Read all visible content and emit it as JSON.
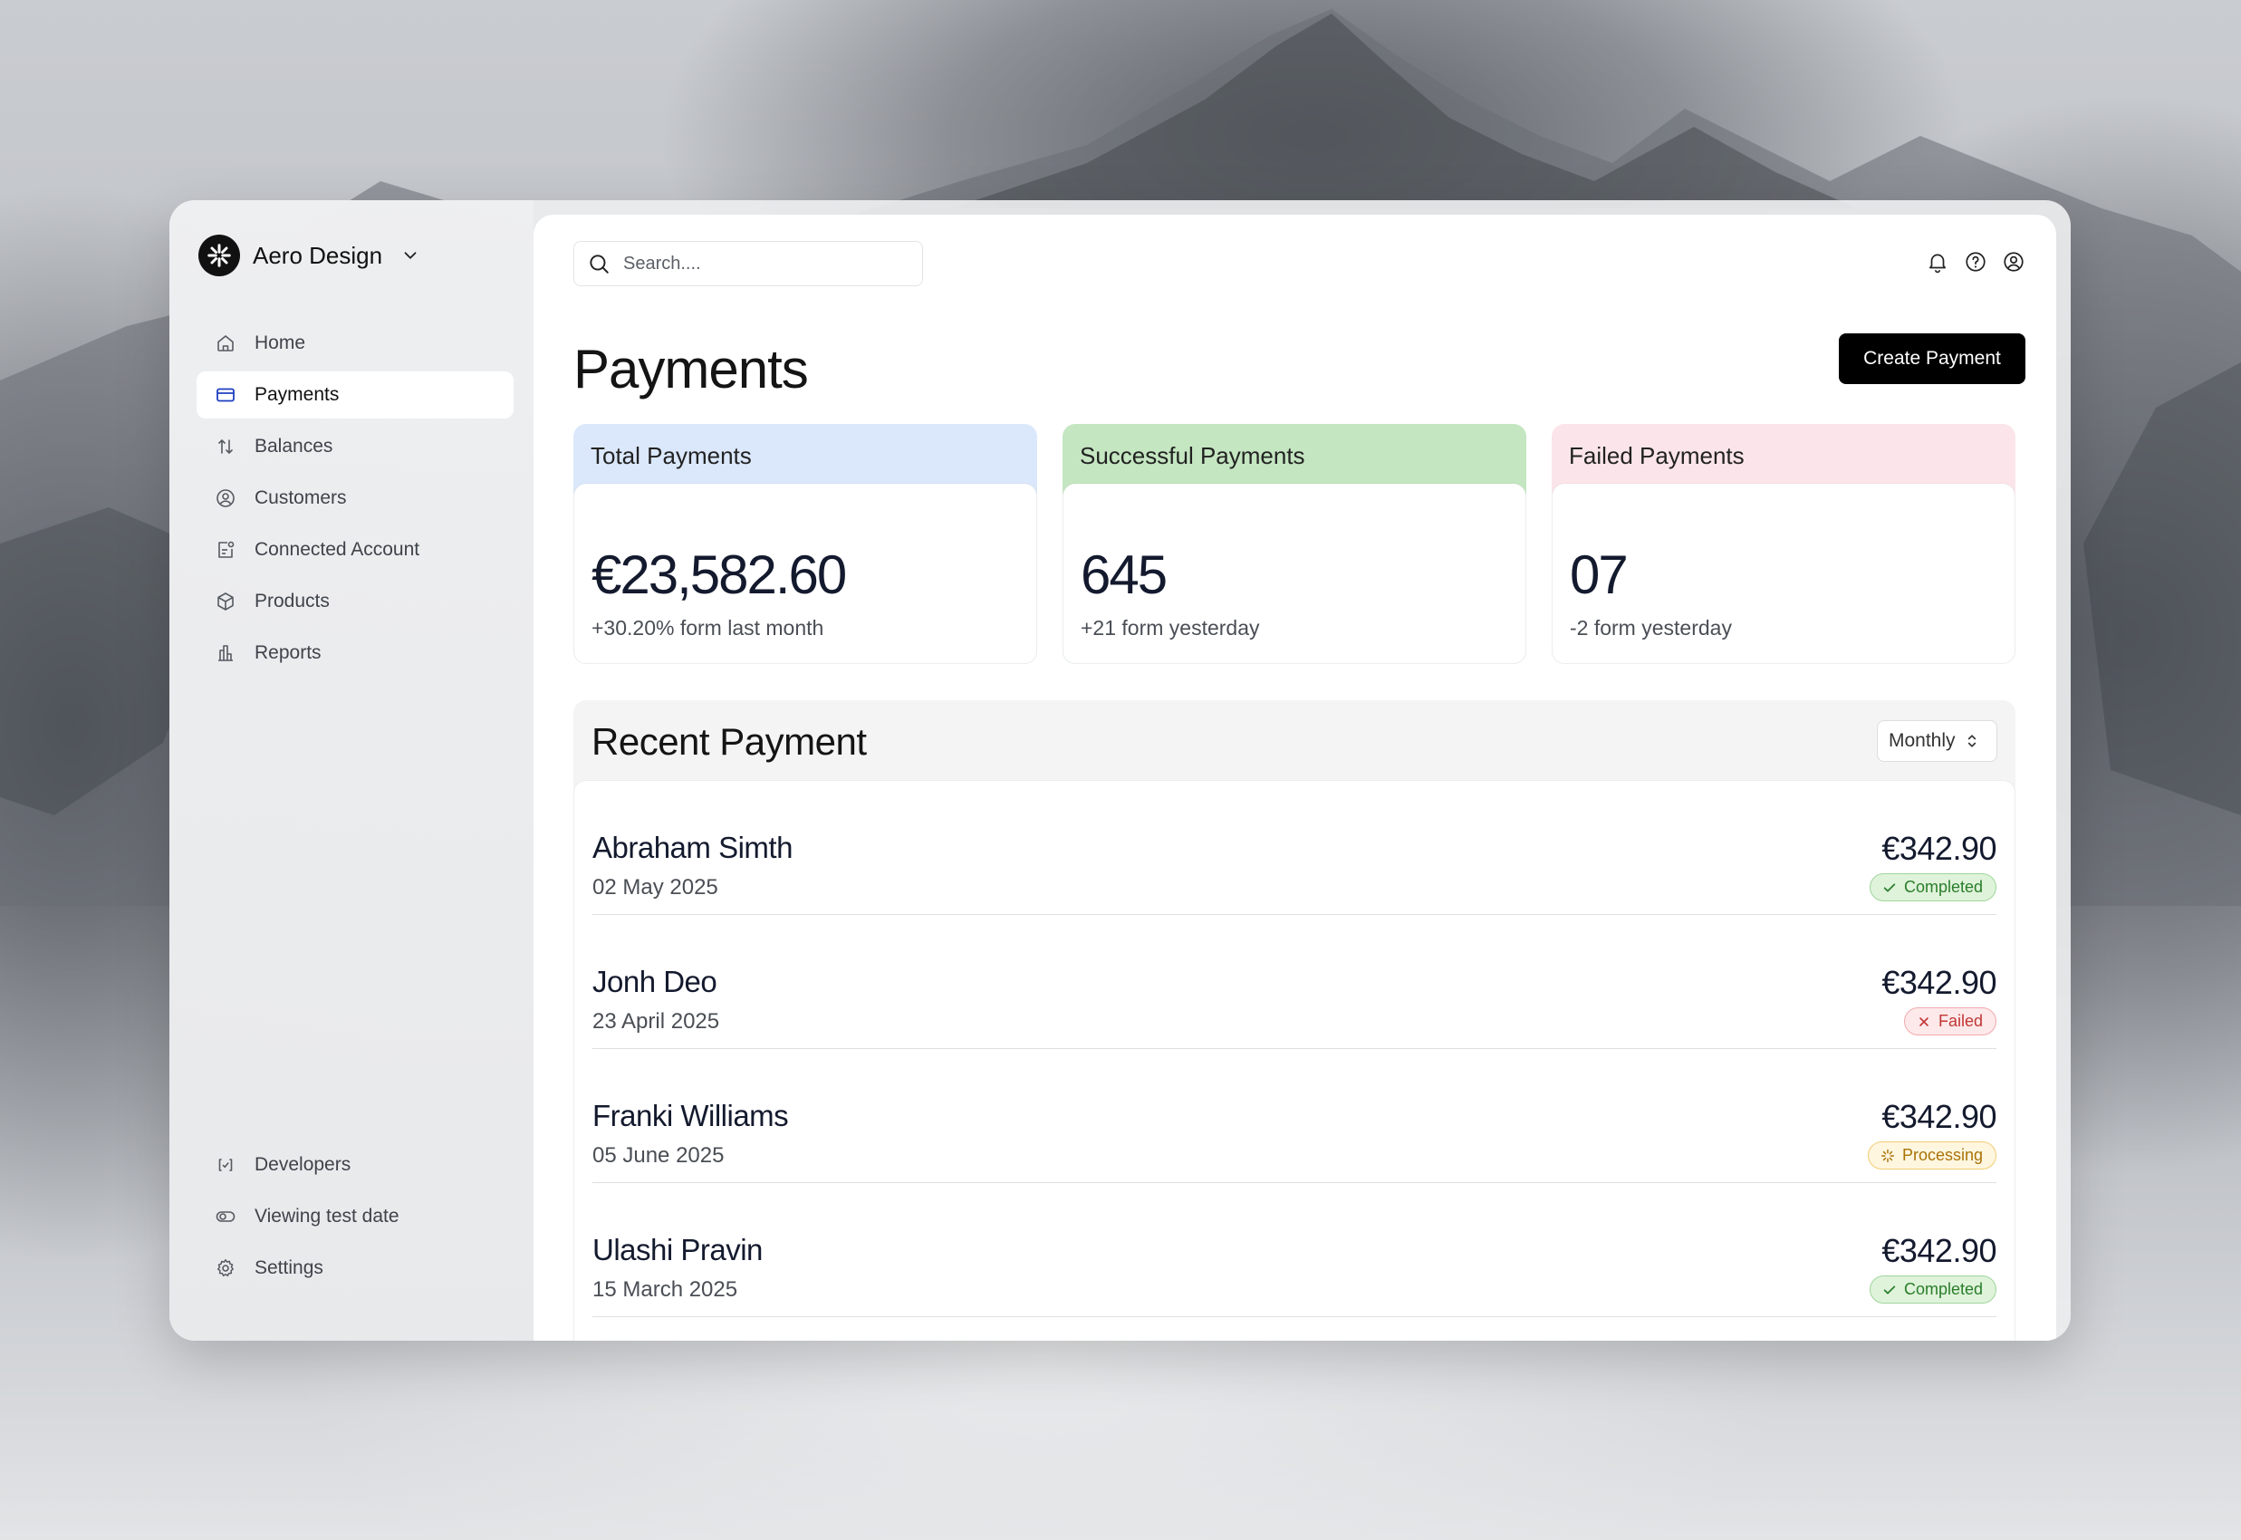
{
  "sidebar": {
    "brand_name": "Aero Design",
    "items": [
      {
        "label": "Home",
        "icon": "home-icon"
      },
      {
        "label": "Payments",
        "icon": "credit-card-icon",
        "active": true
      },
      {
        "label": "Balances",
        "icon": "arrows-up-down-icon"
      },
      {
        "label": "Customers",
        "icon": "user-circle-icon"
      },
      {
        "label": "Connected Account",
        "icon": "connected-account-icon"
      },
      {
        "label": "Products",
        "icon": "box-icon"
      },
      {
        "label": "Reports",
        "icon": "bar-chart-icon"
      }
    ],
    "bottom_items": [
      {
        "label": "Developers",
        "icon": "code-icon"
      },
      {
        "label": "Viewing test date",
        "icon": "toggle-icon"
      },
      {
        "label": "Settings",
        "icon": "gear-icon"
      }
    ]
  },
  "header": {
    "search_placeholder": "Search....",
    "icons": [
      "bell-icon",
      "help-icon",
      "account-icon"
    ]
  },
  "page": {
    "title": "Payments",
    "create_button": "Create Payment"
  },
  "stats": [
    {
      "title": "Total Payments",
      "value": "€23,582.60",
      "sub": "+30.20% form last month",
      "color": "#dbe8fb"
    },
    {
      "title": "Successful Payments",
      "value": "645",
      "sub": "+21 form yesterday",
      "color": "#c4e6c1"
    },
    {
      "title": "Failed Payments",
      "value": "07",
      "sub": "-2 form yesterday",
      "color": "#fbe5ea"
    }
  ],
  "recent": {
    "title": "Recent Payment",
    "period": "Monthly",
    "rows": [
      {
        "name": "Abraham Simth",
        "date": "02 May 2025",
        "amount": "€342.90",
        "status": "Completed"
      },
      {
        "name": "Jonh Deo",
        "date": "23 April 2025",
        "amount": "€342.90",
        "status": "Failed"
      },
      {
        "name": "Franki Williams",
        "date": "05 June 2025",
        "amount": "€342.90",
        "status": "Processing"
      },
      {
        "name": "Ulashi Pravin",
        "date": "15 March 2025",
        "amount": "€342.90",
        "status": "Completed"
      }
    ]
  },
  "colors": {
    "completed": "#2a7d2a",
    "failed": "#c23636",
    "processing": "#a87307",
    "active_nav_icon": "#1f3fbf"
  }
}
